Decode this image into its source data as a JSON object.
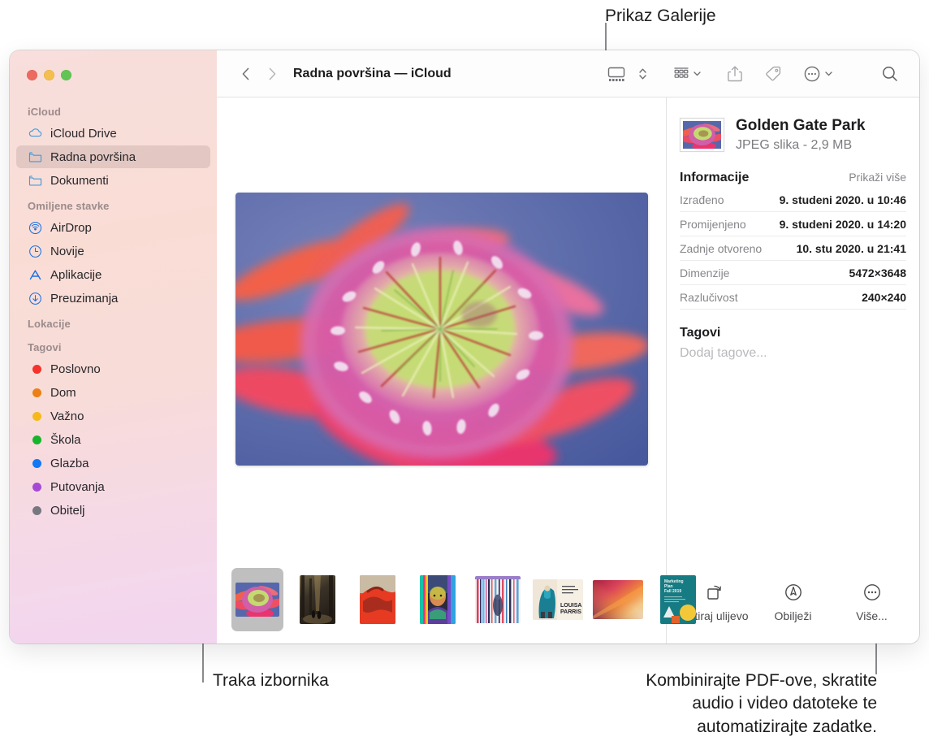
{
  "callouts": [
    {
      "id": "gallery-view",
      "text": "Prikaz Galerije"
    },
    {
      "id": "menu-bar",
      "text": "Traka izbornika"
    },
    {
      "id": "quick-actions",
      "text": "Kombinirajte PDF-ove, skratite\naudio i video datoteke te\nautomatizirajte zadatke."
    }
  ],
  "window": {
    "title": "Radna površina — iCloud",
    "traffic_lights": [
      {
        "name": "close",
        "color": "#ec6a5f"
      },
      {
        "name": "minimize",
        "color": "#f4bf4f"
      },
      {
        "name": "zoom",
        "color": "#61c554"
      }
    ]
  },
  "toolbar": {
    "back": "back-icon",
    "forward": "forward-icon",
    "view_gallery": "gallery-view-icon",
    "view_stepper": "chevron-up-down-icon",
    "group_by": "group-by-icon",
    "share": "share-icon",
    "tag": "tag-icon",
    "more": "more-actions-icon",
    "search": "search-icon"
  },
  "sidebar": {
    "groups": [
      {
        "header": "iCloud",
        "items": [
          {
            "label": "iCloud Drive",
            "icon": "cloud-icon",
            "selected": false
          },
          {
            "label": "Radna površina",
            "icon": "folder-icon",
            "selected": true
          },
          {
            "label": "Dokumenti",
            "icon": "folder-icon",
            "selected": false
          }
        ]
      },
      {
        "header": "Omiljene stavke",
        "items": [
          {
            "label": "AirDrop",
            "icon": "airdrop-icon",
            "selected": false
          },
          {
            "label": "Novije",
            "icon": "clock-icon",
            "selected": false
          },
          {
            "label": "Aplikacije",
            "icon": "applications-icon",
            "selected": false
          },
          {
            "label": "Preuzimanja",
            "icon": "downloads-icon",
            "selected": false
          }
        ]
      },
      {
        "header": "Lokacije",
        "items": []
      },
      {
        "header": "Tagovi",
        "items": [
          {
            "label": "Poslovno",
            "icon": "tag-dot-icon",
            "color": "#f5322c",
            "selected": false
          },
          {
            "label": "Dom",
            "icon": "tag-dot-icon",
            "color": "#ec8013",
            "selected": false
          },
          {
            "label": "Važno",
            "icon": "tag-dot-icon",
            "color": "#f5b91c",
            "selected": false
          },
          {
            "label": "Škola",
            "icon": "tag-dot-icon",
            "color": "#16b52c",
            "selected": false
          },
          {
            "label": "Glazba",
            "icon": "tag-dot-icon",
            "color": "#1278f3",
            "selected": false
          },
          {
            "label": "Putovanja",
            "icon": "tag-dot-icon",
            "color": "#a64ad6",
            "selected": false
          },
          {
            "label": "Obitelj",
            "icon": "tag-dot-icon",
            "color": "#777780",
            "selected": false
          }
        ]
      }
    ]
  },
  "preview": {
    "name": "Golden Gate Park"
  },
  "filmstrip": {
    "items": [
      {
        "name": "golden-gate-park",
        "selected": true
      },
      {
        "name": "forest-path",
        "selected": false
      },
      {
        "name": "red-hands",
        "selected": false
      },
      {
        "name": "portrait-neon",
        "selected": false
      },
      {
        "name": "striped-figure",
        "selected": false
      },
      {
        "name": "louisa-parris",
        "selected": false
      },
      {
        "name": "orange-gradient",
        "selected": false
      },
      {
        "name": "marketing-plan",
        "selected": false
      }
    ]
  },
  "info": {
    "file_name": "Golden Gate Park",
    "file_sub": "JPEG slika - 2,9 MB",
    "section_title": "Informacije",
    "section_action": "Prikaži više",
    "rows": [
      {
        "key": "Izrađeno",
        "value": "9. studeni 2020. u 10:46"
      },
      {
        "key": "Promijenjeno",
        "value": "9. studeni 2020. u 14:20"
      },
      {
        "key": "Zadnje otvoreno",
        "value": "10. stu 2020. u 21:41"
      },
      {
        "key": "Dimenzije",
        "value": "5472×3648"
      },
      {
        "key": "Razlučivost",
        "value": "240×240"
      }
    ],
    "tags_title": "Tagovi",
    "tags_placeholder": "Dodaj tagove..."
  },
  "quick_actions": [
    {
      "label": "Rotiraj ulijevo",
      "icon": "rotate-left-icon"
    },
    {
      "label": "Obilježi",
      "icon": "markup-icon"
    },
    {
      "label": "Više...",
      "icon": "more-circle-icon"
    }
  ]
}
